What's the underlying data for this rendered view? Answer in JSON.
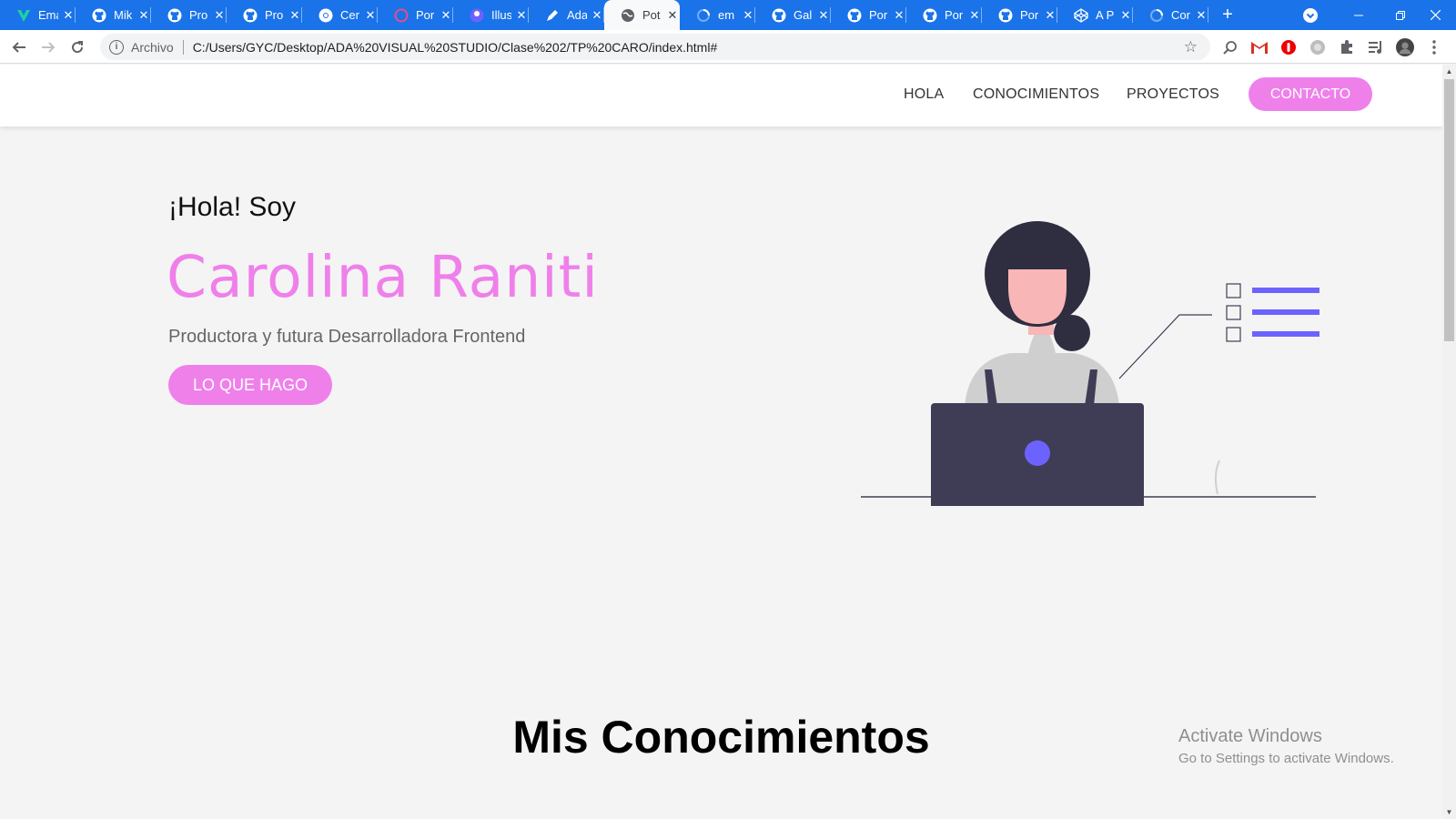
{
  "browser": {
    "tabs": [
      {
        "title": "Ema",
        "icon": "vuetify-icon",
        "color": "#1dd1a1"
      },
      {
        "title": "Mik",
        "icon": "github-icon"
      },
      {
        "title": "Pro",
        "icon": "github-icon"
      },
      {
        "title": "Pro",
        "icon": "github-icon"
      },
      {
        "title": "Cer",
        "icon": "chrome-icon"
      },
      {
        "title": "Por",
        "icon": "dribbble-icon",
        "color": "#ea4c89"
      },
      {
        "title": "Illus",
        "icon": "illustration-icon",
        "color": "#6c63ff"
      },
      {
        "title": "Ada",
        "icon": "pen-icon"
      },
      {
        "title": "Pot",
        "icon": "globe-icon",
        "active": true
      },
      {
        "title": "em",
        "icon": "loading-icon"
      },
      {
        "title": "Gal",
        "icon": "github-icon"
      },
      {
        "title": "Por",
        "icon": "github-icon"
      },
      {
        "title": "Por",
        "icon": "github-icon"
      },
      {
        "title": "Por",
        "icon": "github-icon"
      },
      {
        "title": "A P",
        "icon": "codepen-icon"
      },
      {
        "title": "Cor",
        "icon": "loading-icon"
      }
    ],
    "close_glyph": "✕",
    "new_tab_glyph": "+",
    "address": {
      "scheme_label": "Archivo",
      "url": "C:/Users/GYC/Desktop/ADA%20VISUAL%20STUDIO/Clase%202/TP%20CARO/index.html#"
    },
    "accent": "#1a73e8"
  },
  "nav": {
    "links": [
      "HOLA",
      "CONOCIMIENTOS",
      "PROYECTOS"
    ],
    "contact_label": "CONTACTO"
  },
  "hero": {
    "greeting": "¡Hola! Soy",
    "name": "Carolina Raniti",
    "subtitle": "Productora y futura Desarrolladora Frontend",
    "cta_label": "LO QUE HAGO"
  },
  "section": {
    "title": "Mis Conocimientos"
  },
  "watermark": {
    "line1": "Activate Windows",
    "line2": "Go to Settings to activate Windows."
  },
  "colors": {
    "brand_pink": "#ef80ea",
    "illustration_purple": "#6c63ff",
    "illustration_dark": "#3f3d56",
    "page_bg": "#f4f4f4"
  }
}
